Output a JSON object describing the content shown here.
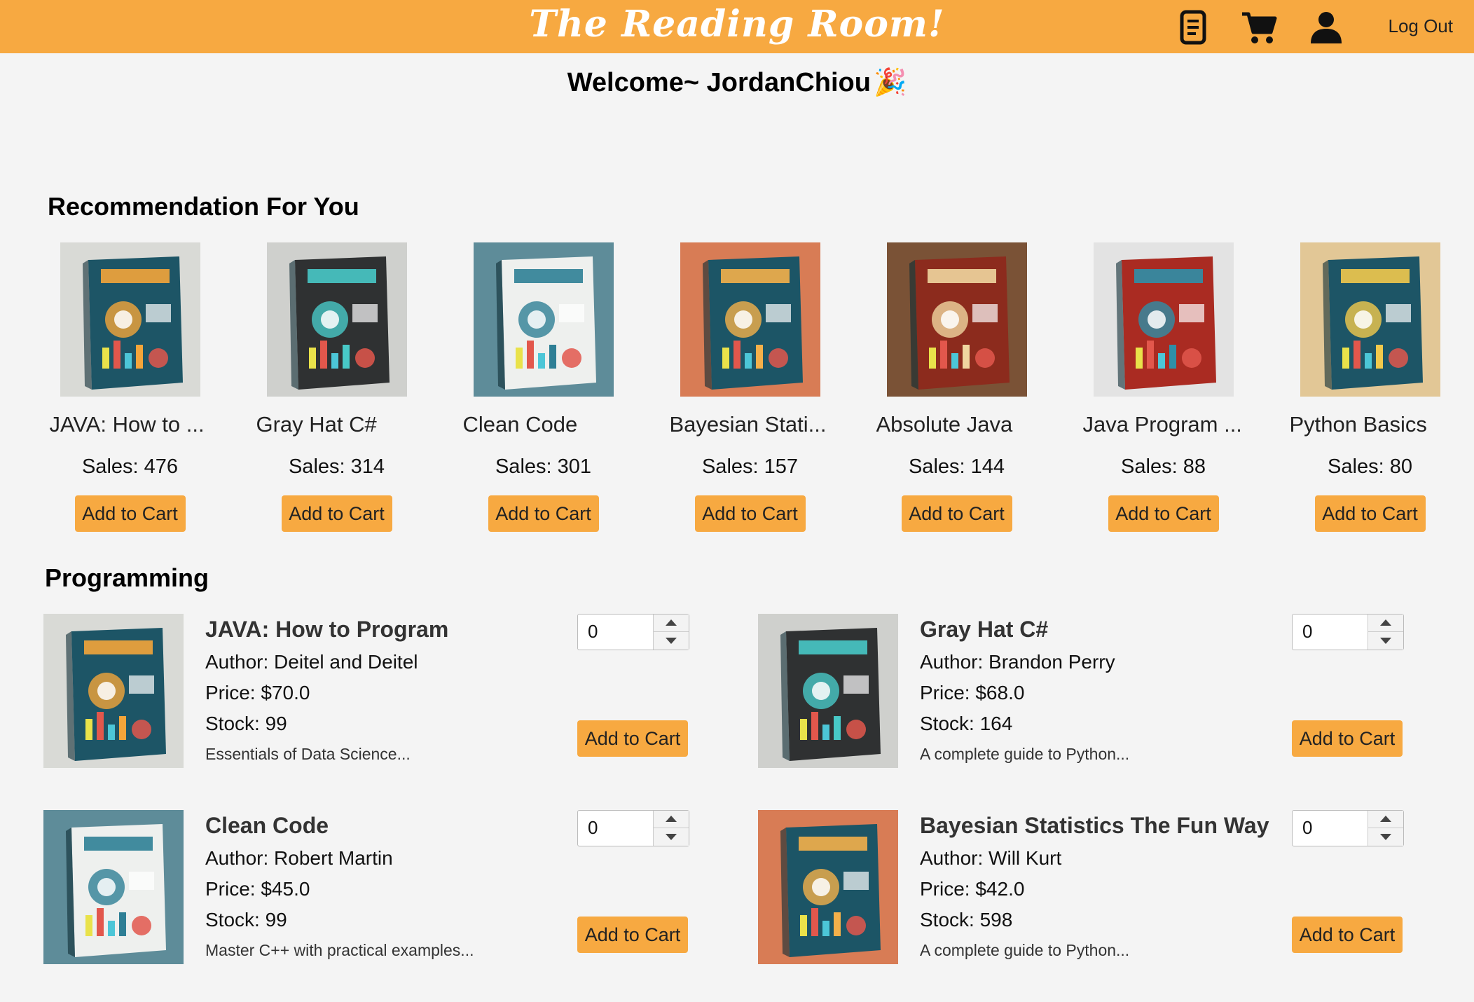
{
  "header": {
    "brand": "The Reading Room!",
    "icons": [
      "orders-icon",
      "cart-icon",
      "user-icon"
    ],
    "logout_label": "Log Out",
    "bar_color": "#f7a941"
  },
  "welcome": {
    "text": "Welcome~ JordanChiou",
    "emoji": "🎉"
  },
  "recommendation": {
    "title": "Recommendation For You",
    "items": [
      {
        "title": "JAVA: How to ...",
        "sales": "Sales: 476",
        "button": "Add to Cart",
        "cover": "java"
      },
      {
        "title": "Gray Hat C#",
        "sales": "Sales: 314",
        "button": "Add to Cart",
        "cover": "grayhat"
      },
      {
        "title": "Clean Code",
        "sales": "Sales: 301",
        "button": "Add to Cart",
        "cover": "cleancode"
      },
      {
        "title": "Bayesian Stati...",
        "sales": "Sales: 157",
        "button": "Add to Cart",
        "cover": "bayesian"
      },
      {
        "title": "Absolute Java",
        "sales": "Sales: 144",
        "button": "Add to Cart",
        "cover": "absjava"
      },
      {
        "title": "Java Program ...",
        "sales": "Sales: 88",
        "button": "Add to Cart",
        "cover": "javaprog"
      },
      {
        "title": "Python Basics",
        "sales": "Sales: 80",
        "button": "Add to Cart",
        "cover": "python"
      }
    ]
  },
  "programming": {
    "title": "Programming",
    "items": [
      {
        "title": "JAVA: How to Program",
        "author": "Author: Deitel and Deitel",
        "price": "Price: $70.0",
        "stock": "Stock: 99",
        "desc": "Essentials of Data Science...",
        "qty": "0",
        "button": "Add to Cart",
        "cover": "java"
      },
      {
        "title": "Gray Hat C#",
        "author": "Author: Brandon Perry",
        "price": "Price: $68.0",
        "stock": "Stock: 164",
        "desc": "A complete guide to Python...",
        "qty": "0",
        "button": "Add to Cart",
        "cover": "grayhat"
      },
      {
        "title": "Clean Code",
        "author": "Author: Robert Martin",
        "price": "Price: $45.0",
        "stock": "Stock: 99",
        "desc": "Master C++ with practical examples...",
        "qty": "0",
        "button": "Add to Cart",
        "cover": "cleancode"
      },
      {
        "title": "Bayesian Statistics The Fun Way",
        "author": "Author: Will Kurt",
        "price": "Price: $42.0",
        "stock": "Stock: 598",
        "desc": "A complete guide to Python...",
        "qty": "0",
        "button": "Add to Cart",
        "cover": "bayesian"
      }
    ]
  }
}
